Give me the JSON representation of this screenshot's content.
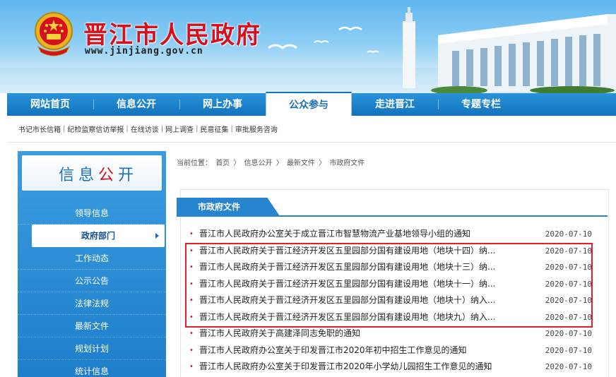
{
  "header": {
    "site_title": "晋江市人民政府",
    "site_url": "www.jinjiang.gov.cn"
  },
  "nav": {
    "items": [
      {
        "label": "网站首页",
        "active": false
      },
      {
        "label": "信息公开",
        "active": false
      },
      {
        "label": "网上办事",
        "active": false
      },
      {
        "label": "公众参与",
        "active": true
      },
      {
        "label": "走进晋江",
        "active": false
      },
      {
        "label": "专题专栏",
        "active": false
      }
    ]
  },
  "sublinks": [
    "书记市长信箱",
    "纪检监察信访举报",
    "在线访谈",
    "网上调查",
    "民意征集",
    "审批服务咨询"
  ],
  "sidebar": {
    "heading_part1": "信息",
    "heading_part2": "公",
    "heading_part3": "开",
    "items": [
      {
        "label": "领导信息",
        "active": false
      },
      {
        "label": "政府部门",
        "active": true
      },
      {
        "label": "工作动态",
        "active": false
      },
      {
        "label": "公示公告",
        "active": false
      },
      {
        "label": "法律法规",
        "active": false
      },
      {
        "label": "最新文件",
        "active": false
      },
      {
        "label": "规划计划",
        "active": false
      },
      {
        "label": "统计信息",
        "active": false
      }
    ]
  },
  "breadcrumb": {
    "prefix": "当前位置：",
    "items": [
      "首页",
      "信息公开",
      "最新文件",
      "市政府文件"
    ],
    "separator": "〉"
  },
  "section": {
    "title": "市政府文件"
  },
  "documents": [
    {
      "title": "晋江市人民政府办公室关于成立晋江市智慧物流产业基地领导小组的通知",
      "date": "2020-07-10"
    },
    {
      "title": "晋江市人民政府关于晋江经济开发区五里园部分国有建设用地（地块十四）纳...",
      "date": "2020-07-10"
    },
    {
      "title": "晋江市人民政府关于晋江经济开发区五里园部分国有建设用地（地块十三）纳...",
      "date": "2020-07-10"
    },
    {
      "title": "晋江市人民政府关于晋江经济开发区五里园部分国有建设用地（地块十一）纳...",
      "date": "2020-07-10"
    },
    {
      "title": "晋江市人民政府关于晋江经济开发区五里园部分国有建设用地（地块十）纳入...",
      "date": "2020-07-10"
    },
    {
      "title": "晋江市人民政府关于晋江经济开发区五里园部分国有建设用地（地块九）纳入...",
      "date": "2020-07-10"
    },
    {
      "title": "晋江市人民政府关于高建泽同志免职的通知",
      "date": "2020-07-10"
    },
    {
      "title": "晋江市人民政府办公室关于印发晋江市2020年初中招生工作意见的通知",
      "date": "2020-07-10"
    },
    {
      "title": "晋江市人民政府办公室关于印发晋江市2020年小学幼儿园招生工作意见的通知",
      "date": "2020-07-10"
    }
  ],
  "colors": {
    "brand_red": "#d4111c",
    "nav_blue": "#1273bd",
    "sidebar_blue": "#2785cf",
    "highlight_red": "#e0202a"
  }
}
